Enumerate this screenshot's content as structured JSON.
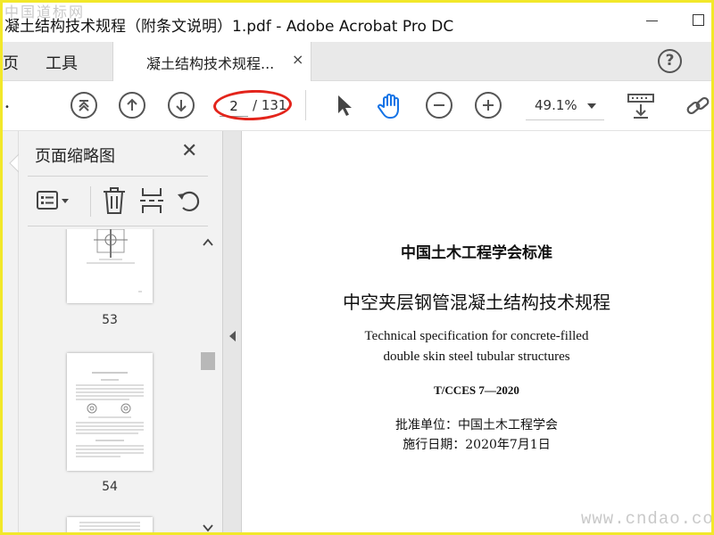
{
  "window": {
    "title": "凝土结构技术规程（附条文说明）1.pdf - Adobe Acrobat Pro DC",
    "watermark_top": "中国道标网"
  },
  "menu": {
    "home": "页",
    "tools": "工具"
  },
  "tab": {
    "label": "凝土结构技术规程...",
    "close": "×"
  },
  "toolbar": {
    "current_page": "2",
    "total_pages": "/ 131",
    "zoom": "49.1%"
  },
  "thumbnail_panel": {
    "title": "页面缩略图",
    "close": "✕",
    "pages": [
      {
        "number": "53"
      },
      {
        "number": "54"
      }
    ]
  },
  "document": {
    "lines": [
      "中国土木工程学会标准",
      "中空夹层钢管混凝土结构技术规程",
      "Technical specification for concrete-filled",
      "double skin steel tubular structures",
      "T/CCES 7—2020",
      "批准单位：中国土木工程学会",
      "施行日期：2020年7月1日"
    ]
  },
  "watermark_bottom": "www.cndao.com",
  "colors": {
    "hand_tool_accent": "#1473e6",
    "highlight_ring": "#e3241b",
    "frame": "#f2e82a"
  }
}
